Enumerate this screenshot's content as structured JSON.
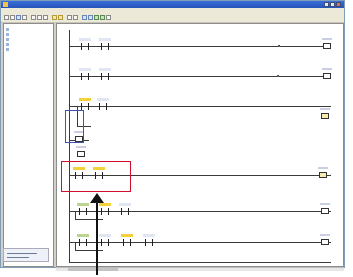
{
  "window": {
    "title": "",
    "icon": "app-icon"
  },
  "menubar": {
    "items": []
  },
  "toolbar": {
    "buttons": [
      "new",
      "open",
      "save",
      "print",
      "cut",
      "copy",
      "paste",
      "undo",
      "redo",
      "zoom",
      "find",
      "contact",
      "coil",
      "instruction",
      "monitor",
      "compile"
    ]
  },
  "sidebar": {
    "items": []
  },
  "ladder": {
    "rung_count": 8,
    "highlighted_rung": 5
  },
  "annotation": {
    "highlight_color": "#d0102a",
    "arrow_color": "#111111"
  }
}
